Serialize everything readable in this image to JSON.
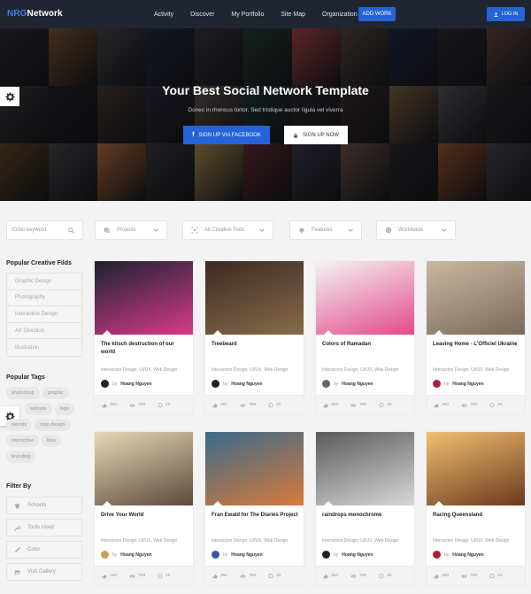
{
  "nav": {
    "logo_brand": "NRG",
    "logo_rest": "Network",
    "links": [
      "Activity",
      "Discover",
      "My Portfolio",
      "Site Map",
      "Organization"
    ],
    "add_work": "ADD WORK",
    "login": "LOG IN"
  },
  "hero": {
    "title": "Your Best Social Network Template",
    "subtitle": "Donec in rhoncus tortor. Sed tristique auctor ligula vel viverra",
    "fb_button": "SIGN UP VIA FACEBOOK",
    "signup_button": "SIGN UP NOW",
    "tile_colors": [
      "#2e2e2e",
      "#8a5a2a",
      "#4a4a4a",
      "#1f2a3a",
      "#3a3a3a",
      "#2a4030",
      "#c04848",
      "#5a4a3a",
      "#1e2a44",
      "#2b2b2b",
      "#6a4a3a",
      "#3b3b3b",
      "#1e1e1e",
      "#4a3a2a",
      "#2a2a38",
      "#6a5a4a",
      "#1e3a3a",
      "#2c2c2c",
      "#3a2a2a",
      "#8a6a3a",
      "#5a5a5a",
      "#2a2a2a",
      "#6a4a1e",
      "#4a4a4a",
      "#d07a3a",
      "#3a3a3a",
      "#c8a050",
      "#6a2a2a",
      "#3a3a4a",
      "#7a5a4a",
      "#2a2a2a",
      "#b05a2a",
      "#4a4a4a"
    ]
  },
  "filters": {
    "keyword_placeholder": "Enter keyword",
    "projects": "Projects",
    "creative": "All Creative Filds",
    "features": "Features",
    "worldwide": "Worldwide"
  },
  "sidebar": {
    "popular_fields_title": "Popular Creative Filds",
    "fields": [
      "Graphic Design",
      "Photography",
      "Interaction Design",
      "Art Direction",
      "Illustration"
    ],
    "popular_tags_title": "Popular Tags",
    "tags": [
      "photoshop",
      "graphic",
      "",
      "website",
      "logo",
      "identity",
      "logo design",
      "interactive",
      "blue",
      "branding"
    ],
    "filter_by_title": "Filter By",
    "filter_by": [
      "Schools",
      "Tools Used",
      "Color",
      "Visit Gallery"
    ]
  },
  "cards": [
    {
      "title": "The kitsch destruction of our world",
      "cats": "Interaction Design, UI/UX, Web Design",
      "by": "by",
      "author": "Hoang Nguyen",
      "likes": "360",
      "views": "789",
      "comments": "20",
      "img_a": "#1c2230",
      "img_b": "#d83a8a",
      "avatar": "#222"
    },
    {
      "title": "Treebeard",
      "cats": "Interaction Design, UI/UX, Web Design",
      "by": "by",
      "author": "Hoang Nguyen",
      "likes": "360",
      "views": "789",
      "comments": "20",
      "img_a": "#3a2a22",
      "img_b": "#8a6a4a",
      "avatar": "#222"
    },
    {
      "title": "Colors of Ramadan",
      "cats": "Interaction Design, UI/UX, Web Design",
      "by": "by",
      "author": "Hoang Nguyen",
      "likes": "360",
      "views": "789",
      "comments": "20",
      "img_a": "#f4f4f4",
      "img_b": "#e24a8a",
      "avatar": "#666"
    },
    {
      "title": "Leaving Home - L'Officiel Ukraine",
      "cats": "Interaction Design, UI/UX, Web Design",
      "by": "by",
      "author": "Hoang Nguyen",
      "likes": "360",
      "views": "789",
      "comments": "20",
      "img_a": "#c8b8a2",
      "img_b": "#7a6a5a",
      "avatar": "#a23"
    },
    {
      "title": "Drive Your World",
      "cats": "Interaction Design, UI/UX, Web Design",
      "by": "by",
      "author": "Hoang Nguyen",
      "likes": "360",
      "views": "789",
      "comments": "20",
      "img_a": "#e8d8b8",
      "img_b": "#5a4a3a",
      "avatar": "#c8a060"
    },
    {
      "title": "Fran Ewald for The Diaries Project",
      "cats": "Interaction Design, UI/UX, Web Design",
      "by": "by",
      "author": "Hoang Nguyen",
      "likes": "360",
      "views": "789",
      "comments": "20",
      "img_a": "#3a6a8a",
      "img_b": "#d87a3a",
      "avatar": "#3a5aa0"
    },
    {
      "title": "raindrops monochrome",
      "cats": "Interaction Design, UI/UX, Web Design",
      "by": "by",
      "author": "Hoang Nguyen",
      "likes": "360",
      "views": "789",
      "comments": "20",
      "img_a": "#5a5a5a",
      "img_b": "#d8d8d8",
      "avatar": "#222"
    },
    {
      "title": "Racing Queensland",
      "cats": "Interaction Design, UI/UX, Web Design",
      "by": "by",
      "author": "Hoang Nguyen",
      "likes": "360",
      "views": "789",
      "comments": "20",
      "img_a": "#f0c070",
      "img_b": "#6a3a1e",
      "avatar": "#a23"
    }
  ],
  "colors": {
    "accent": "#2563d6",
    "nav_bg": "#202631"
  }
}
